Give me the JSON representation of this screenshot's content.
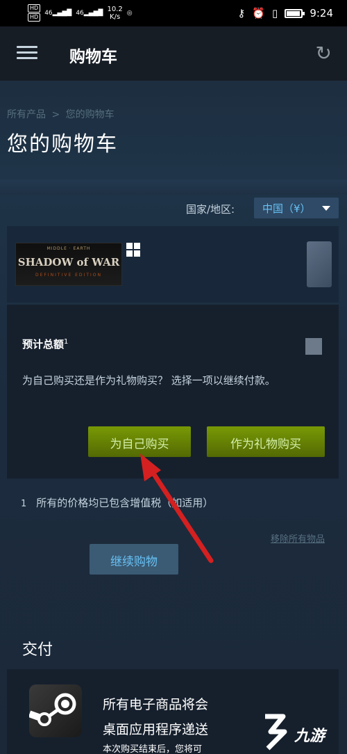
{
  "status_bar": {
    "hd1": "HD",
    "hd2": "HD",
    "signal1": "46",
    "signal2": "46",
    "speed_value": "10.2",
    "speed_unit": "K/s",
    "time": "9:24"
  },
  "header": {
    "title": "购物车"
  },
  "breadcrumb": {
    "root": "所有产品",
    "separator": ">",
    "current": "您的购物车"
  },
  "page_title": "您的购物车",
  "country": {
    "label": "国家/地区:",
    "selected": "中国（¥）"
  },
  "cart_item": {
    "game_logo_top": "MIDDLE · EARTH",
    "game_logo": "SHADOW of WAR",
    "game_logo_edition": "DEFINITIVE EDITION"
  },
  "total": {
    "label": "预计总额",
    "footnote_marker": "1",
    "prompt": "为自己购买还是作为礼物购买？ 选择一项以继续付款。",
    "buy_self": "为自己购买",
    "buy_gift": "作为礼物购买"
  },
  "footnote": {
    "number": "1",
    "text": "所有的价格均已包含增值税（如适用）"
  },
  "remove_all": "移除所有物品",
  "continue_shopping": "继续购物",
  "delivery": {
    "title": "交付",
    "line1": "所有电子商品将会",
    "line2": "桌面应用程序递送",
    "line3": "本次购买结束后，您将可"
  },
  "watermark": "九游",
  "colors": {
    "accent_green": "#799905",
    "link_blue": "#67c1f5",
    "arrow_red": "#d42020"
  }
}
